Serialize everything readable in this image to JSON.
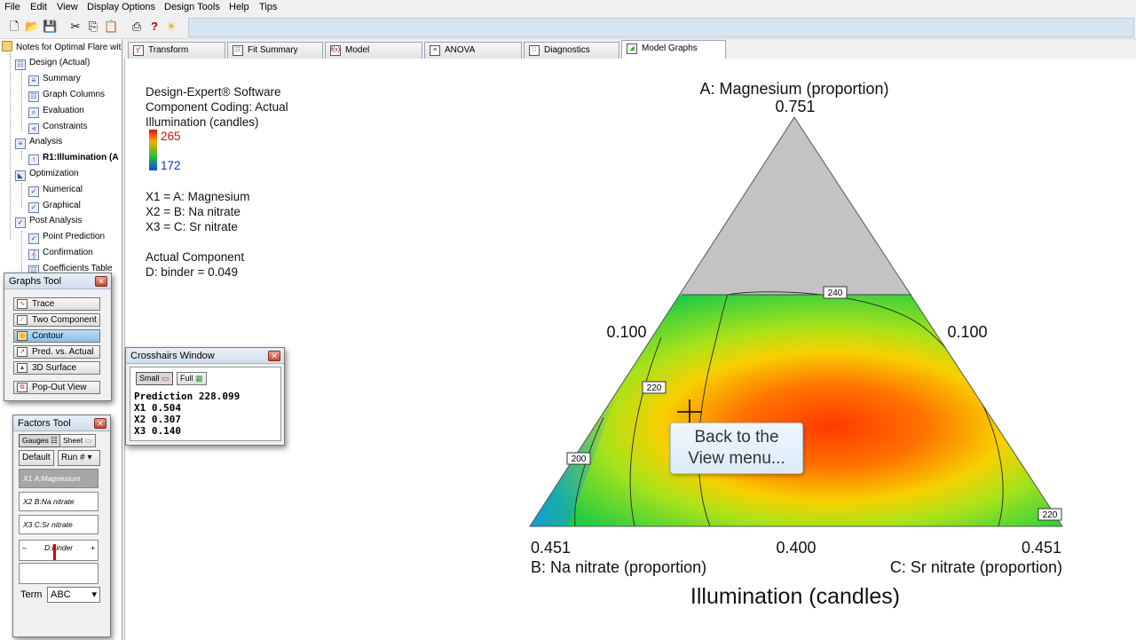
{
  "menu": [
    "File",
    "Edit",
    "View",
    "Display Options",
    "Design Tools",
    "Help",
    "Tips"
  ],
  "toolbar_icons": [
    "new-icon",
    "open-icon",
    "save-icon",
    "cut-icon",
    "copy-icon",
    "paste-icon",
    "print-icon",
    "help-icon",
    "tip-bulb-icon"
  ],
  "tree": {
    "root": "Notes for Optimal Flare wit",
    "items": [
      {
        "label": "Design (Actual)",
        "level": 1
      },
      {
        "label": "Summary",
        "level": 2
      },
      {
        "label": "Graph Columns",
        "level": 2
      },
      {
        "label": "Evaluation",
        "level": 2
      },
      {
        "label": "Constraints",
        "level": 2
      },
      {
        "label": "Analysis",
        "level": 1
      },
      {
        "label": "R1:Illumination (A",
        "level": 2
      },
      {
        "label": "Optimization",
        "level": 1
      },
      {
        "label": "Numerical",
        "level": 2
      },
      {
        "label": "Graphical",
        "level": 2
      },
      {
        "label": "Post Analysis",
        "level": 1
      },
      {
        "label": "Point Prediction",
        "level": 2
      },
      {
        "label": "Confirmation",
        "level": 2
      },
      {
        "label": "Coefficients Table",
        "level": 2
      }
    ]
  },
  "tabs": [
    {
      "label": "Transform"
    },
    {
      "label": "Fit Summary"
    },
    {
      "label": "Model"
    },
    {
      "label": "ANOVA"
    },
    {
      "label": "Diagnostics"
    },
    {
      "label": "Model Graphs",
      "active": true
    }
  ],
  "legend": {
    "software": "Design-Expert® Software",
    "coding": "Component Coding: Actual",
    "response": "Illumination (candles)",
    "max": "265",
    "min": "172",
    "x1": "X1 = A: Magnesium",
    "x2": "X2 = B: Na nitrate",
    "x3": "X3 = C: Sr nitrate",
    "actual_title": "Actual Component",
    "actual_value": "D: binder = 0.049"
  },
  "graph": {
    "top_title": "A: Magnesium (proportion)",
    "top_value": "0.751",
    "left_value": "0.100",
    "right_value": "0.100",
    "bottom_left_value": "0.451",
    "bottom_mid_value": "0.400",
    "bottom_right_value": "0.451",
    "bottom_left_label": "B: Na nitrate (proportion)",
    "bottom_right_label": "C: Sr nitrate (proportion)",
    "title": "Illumination (candles)",
    "contour_labels": [
      "240",
      "220",
      "200",
      "220"
    ]
  },
  "callout": {
    "line1": "Back to the",
    "line2": "View menu..."
  },
  "graphs_tool": {
    "title": "Graphs Tool",
    "buttons": [
      "Trace",
      "Two Component",
      "Contour",
      "Pred. vs. Actual",
      "3D Surface",
      "Pop-Out View"
    ],
    "selected": "Contour"
  },
  "crosshairs": {
    "title": "Crosshairs Window",
    "small_label": "Small",
    "full_label": "Full",
    "prediction": "Prediction 228.099",
    "x1": "X1 0.504",
    "x2": "X2 0.307",
    "x3": "X3 0.140"
  },
  "factors_tool": {
    "title": "Factors Tool",
    "gauges_label": "Gauges",
    "sheet_label": "Sheet",
    "default_label": "Default",
    "run_label": "Run #",
    "factors": [
      {
        "code": "X1",
        "name": "A:Magnesium"
      },
      {
        "code": "X2",
        "name": "B:Na nitrate"
      },
      {
        "code": "X3",
        "name": "C:Sr nitrate"
      }
    ],
    "slider_label": "D:binder",
    "slider_minus": "–",
    "slider_plus": "+",
    "term_label": "Term",
    "term_value": "ABC"
  }
}
